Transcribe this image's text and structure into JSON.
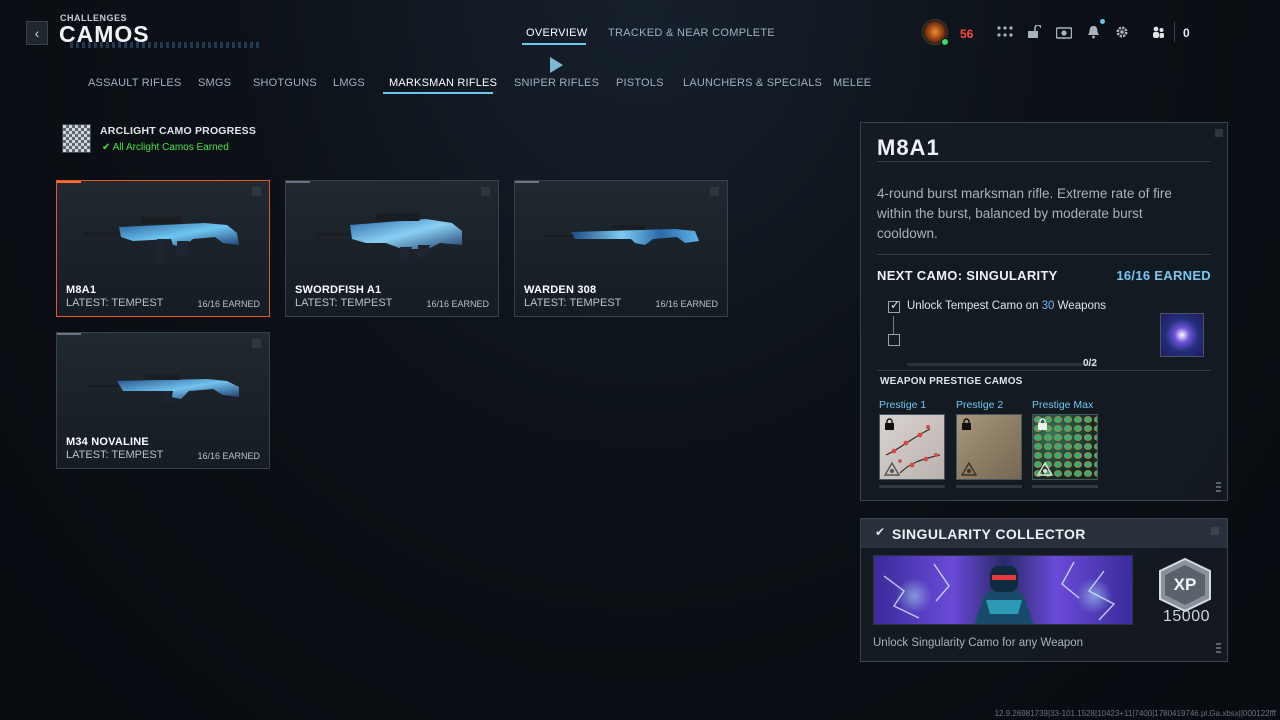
{
  "header": {
    "breadcrumb": "CHALLENGES",
    "title": "CAMOS",
    "tabs": [
      {
        "label": "OVERVIEW",
        "active": true
      },
      {
        "label": "TRACKED & NEAR COMPLETE",
        "active": false
      }
    ],
    "player_level": "56",
    "currency": "0",
    "icons": [
      "grid-icon",
      "unlock-icon",
      "camera-icon",
      "bell-icon",
      "gear-icon",
      "party-icon"
    ]
  },
  "categories": [
    {
      "label": "ASSAULT RIFLES",
      "active": false
    },
    {
      "label": "SMGS",
      "active": false
    },
    {
      "label": "SHOTGUNS",
      "active": false
    },
    {
      "label": "LMGS",
      "active": false
    },
    {
      "label": "MARKSMAN RIFLES",
      "active": true
    },
    {
      "label": "SNIPER RIFLES",
      "active": false
    },
    {
      "label": "PISTOLS",
      "active": false
    },
    {
      "label": "LAUNCHERS & SPECIALS",
      "active": false
    },
    {
      "label": "MELEE",
      "active": false
    }
  ],
  "arclight": {
    "title": "ARCLIGHT CAMO PROGRESS",
    "status": "All Arclight Camos Earned"
  },
  "weapons": [
    {
      "name": "M8A1",
      "latest": "LATEST: TEMPEST",
      "earned": "16/16 EARNED",
      "selected": true
    },
    {
      "name": "SWORDFISH A1",
      "latest": "LATEST: TEMPEST",
      "earned": "16/16 EARNED",
      "selected": false
    },
    {
      "name": "WARDEN 308",
      "latest": "LATEST: TEMPEST",
      "earned": "16/16 EARNED",
      "selected": false
    },
    {
      "name": "M34 NOVALINE",
      "latest": "LATEST: TEMPEST",
      "earned": "16/16 EARNED",
      "selected": false
    }
  ],
  "detail": {
    "title": "M8A1",
    "description": "4-round burst marksman rifle. Extreme rate of fire within the burst, balanced by moderate burst cooldown.",
    "next_camo": "NEXT CAMO: SINGULARITY",
    "earned": "16/16 EARNED",
    "task_prefix": "Unlock Tempest Camo on ",
    "task_number": "30",
    "task_suffix": " Weapons",
    "progress": "0/2",
    "progress_value": 0,
    "prestige_heading": "WEAPON PRESTIGE CAMOS",
    "prestige": [
      {
        "label": "Prestige 1"
      },
      {
        "label": "Prestige 2"
      },
      {
        "label": "Prestige Max"
      }
    ]
  },
  "reward": {
    "title": "SINGULARITY COLLECTOR",
    "xp_label": "XP",
    "xp_amount": "15000",
    "description": "Unlock Singularity Camo for any Weapon"
  },
  "build_string": "12.9.26981739|33-101.1528|10423+11|7400|1780419746.pl.Ga.xbsx||000122fff",
  "colors": {
    "accent": "#6ec6f0",
    "selected_border": "#e05a2a",
    "success": "#4de04a",
    "level": "#ff4a3a"
  }
}
